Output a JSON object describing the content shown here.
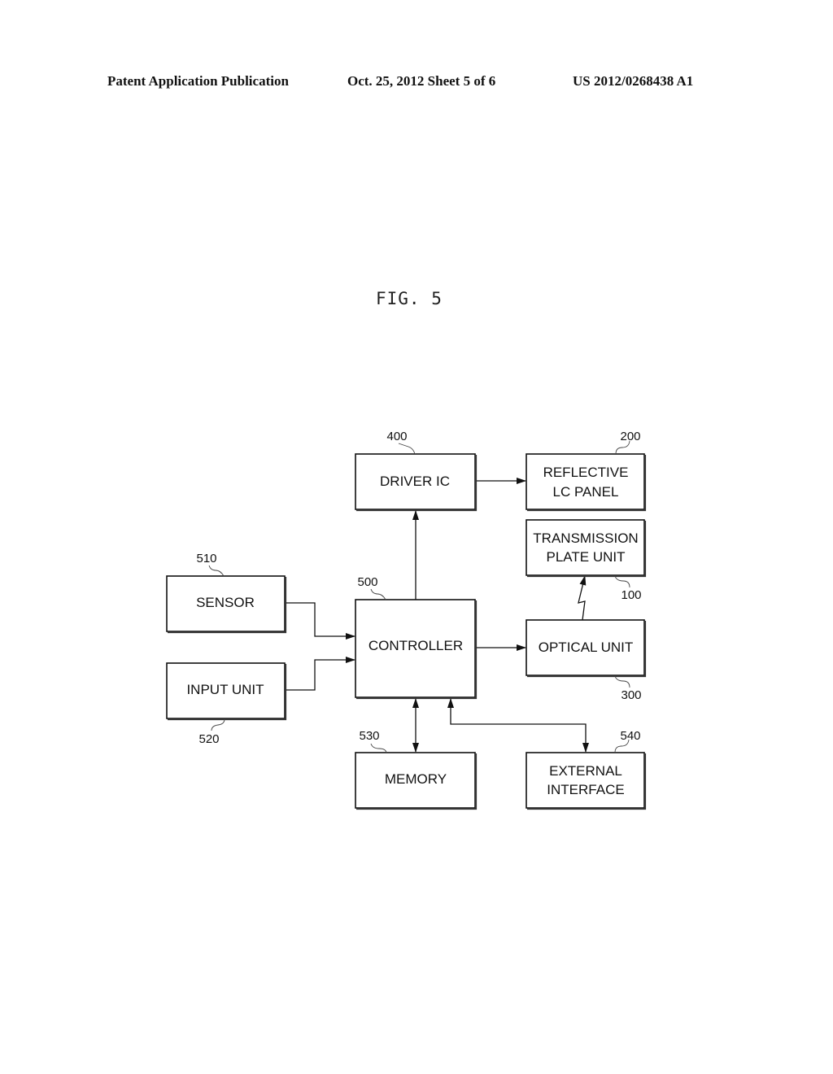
{
  "header": {
    "publication": "Patent Application Publication",
    "date_sheet": "Oct. 25, 2012   Sheet 5 of 6",
    "number": "US 2012/0268438 A1"
  },
  "figure": {
    "title": "FIG. 5"
  },
  "blocks": {
    "driver_ic": {
      "ref": "400",
      "lines": [
        "DRIVER IC"
      ]
    },
    "reflective_lc_panel": {
      "ref": "200",
      "lines": [
        "REFLECTIVE",
        "LC PANEL"
      ]
    },
    "transmission_plate_unit": {
      "ref": "100",
      "lines": [
        "TRANSMISSION",
        "PLATE UNIT"
      ]
    },
    "sensor": {
      "ref": "510",
      "lines": [
        "SENSOR"
      ]
    },
    "controller": {
      "ref": "500",
      "lines": [
        "CONTROLLER"
      ]
    },
    "optical_unit": {
      "ref": "300",
      "lines": [
        "OPTICAL UNIT"
      ]
    },
    "input_unit": {
      "ref": "520",
      "lines": [
        "INPUT UNIT"
      ]
    },
    "memory": {
      "ref": "530",
      "lines": [
        "MEMORY"
      ]
    },
    "external_interface": {
      "ref": "540",
      "lines": [
        "EXTERNAL",
        "INTERFACE"
      ]
    }
  },
  "connections": [
    {
      "from": "controller",
      "to": "driver_ic",
      "type": "arrow"
    },
    {
      "from": "driver_ic",
      "to": "reflective_lc_panel",
      "type": "arrow"
    },
    {
      "from": "sensor",
      "to": "controller",
      "type": "arrow"
    },
    {
      "from": "input_unit",
      "to": "controller",
      "type": "arrow"
    },
    {
      "from": "controller",
      "to": "optical_unit",
      "type": "arrow"
    },
    {
      "from": "optical_unit",
      "to": "transmission_plate_unit",
      "type": "wireless-arrow"
    },
    {
      "from": "controller",
      "to": "memory",
      "type": "bidirectional"
    },
    {
      "from": "controller",
      "to": "external_interface",
      "type": "bidirectional"
    }
  ]
}
